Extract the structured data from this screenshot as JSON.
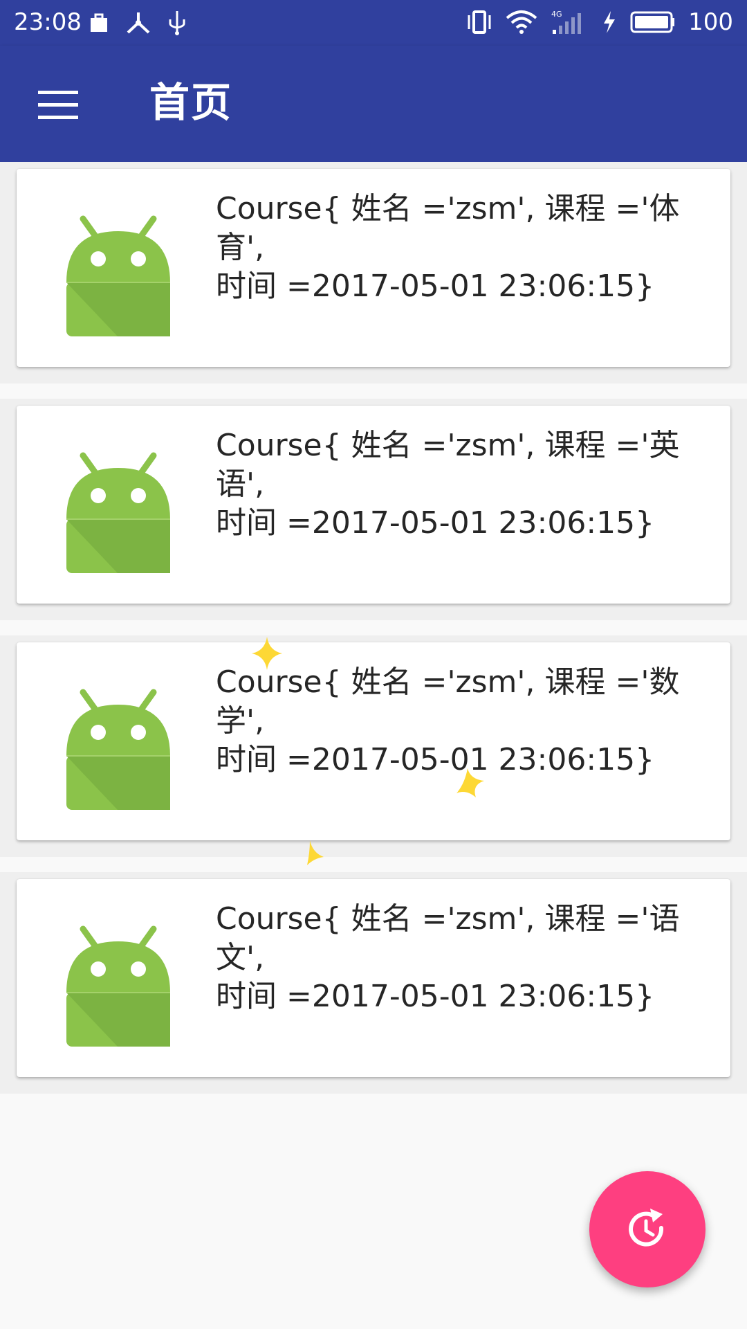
{
  "status_bar": {
    "time": "23:08",
    "battery_percent": "100",
    "left_icons": [
      "briefcase-icon",
      "network-share-icon",
      "usb-icon"
    ],
    "right_icons": [
      "vibrate-icon",
      "wifi-icon",
      "4g-signal-icon",
      "charging-icon",
      "battery-icon"
    ]
  },
  "app_bar": {
    "title": "首页",
    "menu_icon": "hamburger-menu-icon",
    "color": "#30409e"
  },
  "courses": [
    {
      "line1": "Course{ 姓名 ='zsm', 课程 ='体育',",
      "line2": "时间 =2017-05-01 23:06:15}"
    },
    {
      "line1": "Course{ 姓名 ='zsm', 课程 ='英语',",
      "line2": "时间 =2017-05-01 23:06:15}"
    },
    {
      "line1": "Course{ 姓名 ='zsm', 课程 ='数学',",
      "line2": "时间 =2017-05-01 23:06:15}"
    },
    {
      "line1": "Course{ 姓名 ='zsm', 课程 ='语文',",
      "line2": "时间 =2017-05-01 23:06:15}"
    }
  ],
  "item_icon": "android-robot-icon",
  "fab": {
    "icon": "refresh-clock-icon",
    "color": "#fe3f80"
  }
}
